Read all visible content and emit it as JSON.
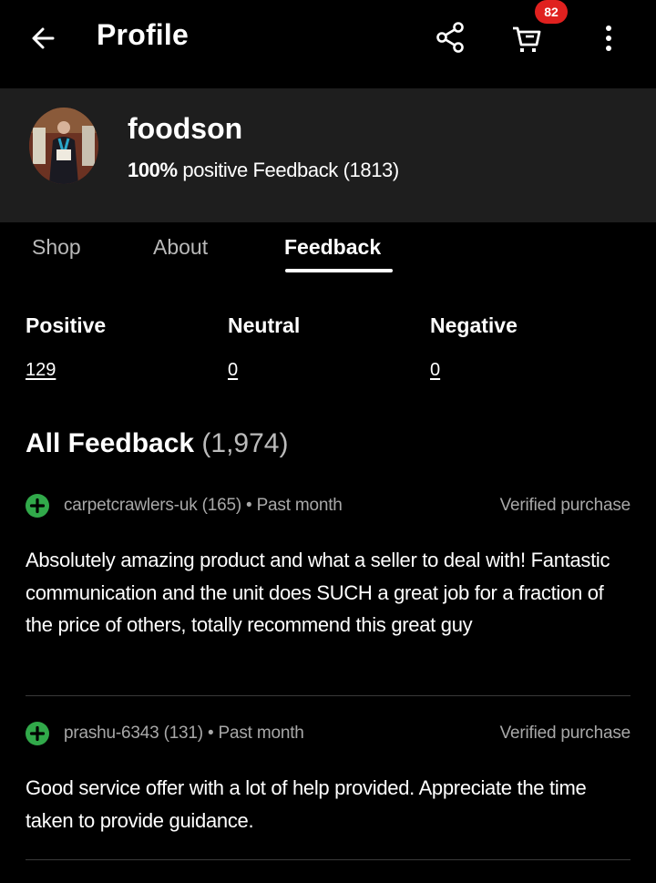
{
  "header": {
    "title": "Profile",
    "cart_count": "82",
    "icons": [
      "back-arrow-icon",
      "share-icon",
      "cart-icon",
      "more-vertical-icon"
    ]
  },
  "profile": {
    "username": "foodson",
    "positive_percent": "100%",
    "feedback_text": "positive Feedback (1813)"
  },
  "tabs": [
    {
      "label": "Shop"
    },
    {
      "label": "About"
    },
    {
      "label": "Feedback"
    }
  ],
  "stats": {
    "positive": {
      "label": "Positive",
      "value": "129"
    },
    "neutral": {
      "label": "Neutral",
      "value": "0"
    },
    "negative": {
      "label": "Negative",
      "value": "0"
    }
  },
  "all_feedback": {
    "title": "All Feedback",
    "count": "(1,974)"
  },
  "reviews": [
    {
      "reviewer": "carpetcrawlers-uk (165) • Past month",
      "badge": "Verified purchase",
      "text": "Absolutely amazing product and what a seller to deal with! Fantastic communication and the unit does SUCH a great job for a fraction of the price of others, totally recommend this great guy"
    },
    {
      "reviewer": "prashu-6343 (131) • Past month",
      "badge": "Verified purchase",
      "text": "Good service offer with a lot of help provided. Appreciate the time taken to provide guidance."
    }
  ],
  "colors": {
    "background": "#000000",
    "card": "#1e1e1e",
    "badge": "#e0211f",
    "positive": "#31a94a",
    "muted_text": "#a8a8a8"
  }
}
